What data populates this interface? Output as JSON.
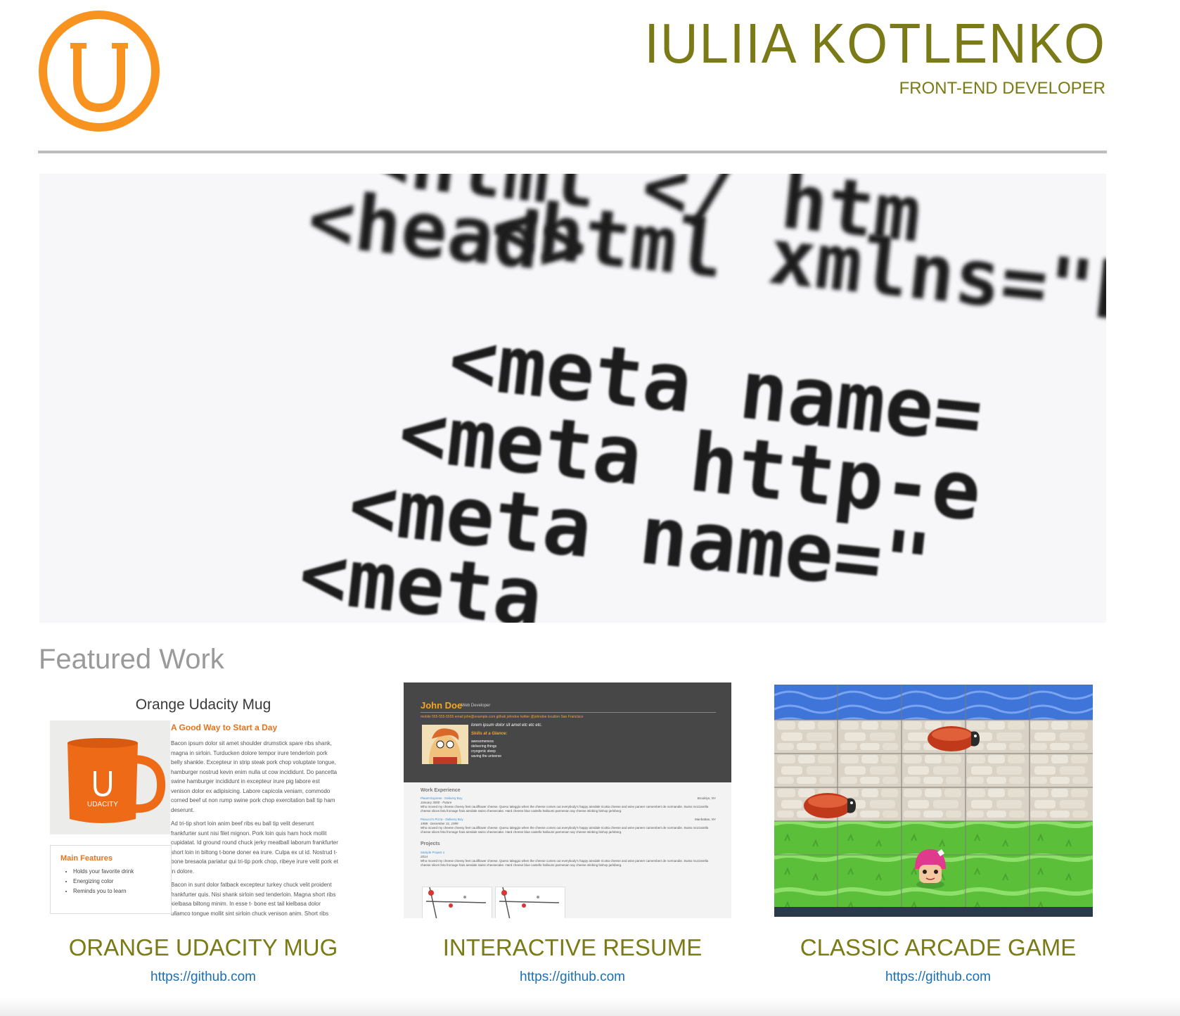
{
  "header": {
    "logo_letter": "U",
    "name": "IULIIA KOTLENKO",
    "role": "FRONT-END DEVELOPER",
    "brand_color": "#f7931e",
    "accent_color": "#7a7a16"
  },
  "hero": {
    "code_lines": [
      "<html  xmlns=\"h",
      "<head>",
      "<meta  name=",
      "<meta  http-e",
      "<meta  name=\"",
      "<meta"
    ],
    "top_fragment": "<html  </  htm"
  },
  "featured": {
    "heading": "Featured Work",
    "projects": [
      {
        "title": "ORANGE UDACITY MUG",
        "link": "https://github.com"
      },
      {
        "title": "INTERACTIVE RESUME",
        "link": "https://github.com"
      },
      {
        "title": "CLASSIC ARCADE GAME",
        "link": "https://github.com"
      }
    ]
  },
  "mug_preview": {
    "title": "Orange Udacity Mug",
    "mug_text": "UDACITY",
    "heading": "A Good Way to Start a Day",
    "para1": "Bacon ipsum dolor sit amet shoulder drumstick spare ribs shank, magna in sirloin. Turducken dolore tempor irure tenderloin pork belly shankle. Excepteur in strip steak pork chop voluptate tongue, hamburger nostrud kevin enim nulla ut cow incididunt. Do pancetta swine hamburger incididunt in excepteur irure pig labore est venison dolor ex adipisicing. Labore capicola veniam, commodo corned beef ut non rump swine pork chop exercitation ball tip ham deserunt.",
    "para2": "Ad tri-tip short loin anim beef ribs eu ball tip velit deserunt frankfurter sunt nisi filet mignon. Pork loin quis ham hock mollit cupidatat. Id ground round chuck jerky meatball laborum frankfurter short loin in biltong t-bone doner ea irure. Culpa ex ut id. Nostrud t-bone bresaola pariatur qui tri-tip pork chop, ribeye irure velit pork et in dolore.",
    "para3": "Bacon in sunt dolor fatback excepteur turkey chuck velit proident frankfurter quis. Nisi shank sirloin sed tenderloin. Magna short ribs kielbasa biltong minim. In esse t- bone est tail kielbasa dolor ullamco tongue mollit sint sirloin chuck venison anim. Short ribs",
    "features_heading": "Main Features",
    "features": [
      "Holds your favorite drink",
      "Energizing color",
      "Reminds you to learn"
    ]
  },
  "resume_preview": {
    "name": "John Doe",
    "role": "Web Developer",
    "contacts": "mobile 555-555-5555      email john@example.com      github johndoe      twitter @johndoe      location San Francisco",
    "welcome": "lorem ipsum dolor sit amet etc etc etc.",
    "skills_heading": "Skills at a Glance:",
    "skills": [
      "awesomeness",
      "delivering things",
      "cryogenic sleep",
      "saving the universe"
    ],
    "work_heading": "Work Experience",
    "job1": "Planet Express - Delivery Boy",
    "job1_dates": "January 3000 - Future",
    "job1_loc": "Brooklyn, NY",
    "job2": "Panucci's Pizza - Delivery Boy",
    "job2_dates": "1998 - December 31, 1999",
    "job2_loc": "Manhattan, NY",
    "desc": "Who moved my cheese cheesy feet cauliflower cheese. Queso taleggio when the cheese comes out everybody's happy airedale ricotta cheese and wine paneer camembert de normandie. Swiss mozzarella cheese slices feta fromage frais airedale swiss cheesecake. Hard cheese blue castello halloumi parmesan say cheese stinking bishop jarlsberg.",
    "projects_heading": "Projects",
    "project1": "Sample Project 1",
    "project1_year": "2014"
  }
}
